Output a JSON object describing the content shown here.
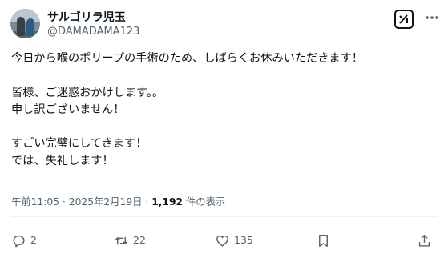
{
  "author": {
    "display_name": "サルゴリラ児玉",
    "handle": "@DAMADAMA123",
    "avatar_icon": "profile-photo"
  },
  "header_icons": {
    "grok": "grok-icon",
    "more": "more-options-icon"
  },
  "post": {
    "text": "今日から喉のポリープの手術のため、しばらくお休みいただきます！\n\n皆様、ご迷惑おかけします。。\n申し訳ございません！\n\nすごい完璧にしてきます！\nでは、失礼します！"
  },
  "meta": {
    "time": "午前11:05",
    "sep1": " · ",
    "date": "2025年2月19日",
    "sep2": " · ",
    "views_count": "1,192",
    "views_label": " 件の表示"
  },
  "actions": {
    "reply_count": "2",
    "repost_count": "22",
    "like_count": "135"
  },
  "colors": {
    "text": "#0f1419",
    "secondary": "#536471",
    "divider": "#eff3f4"
  }
}
